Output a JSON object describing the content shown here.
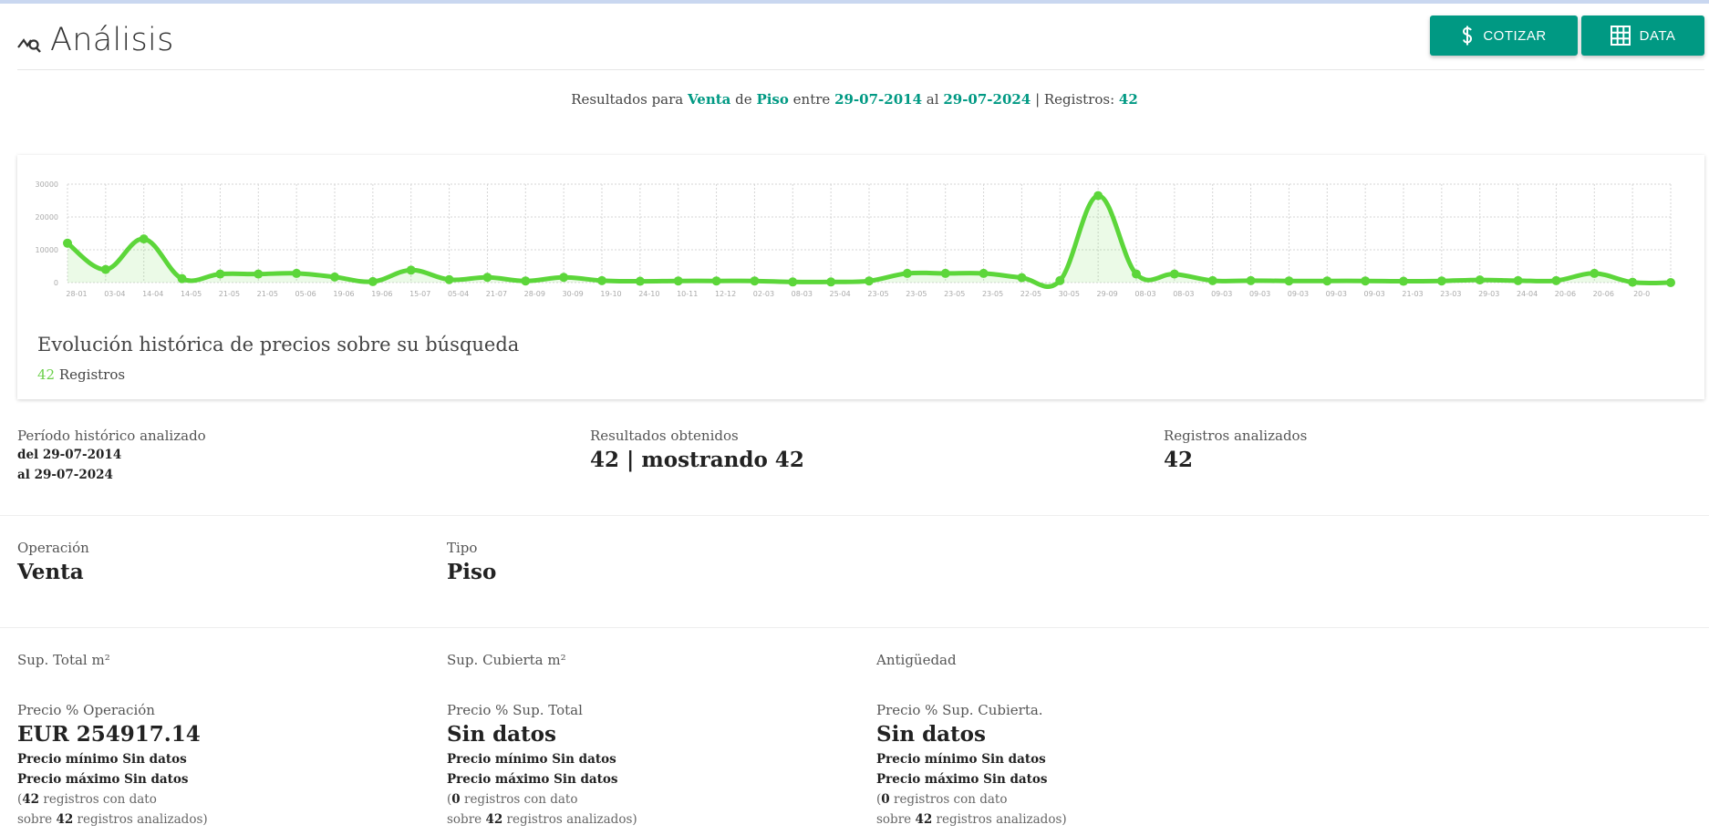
{
  "header": {
    "title": "Análisis",
    "cotizar_label": "COTIZAR",
    "data_label": "DATA"
  },
  "summary": {
    "prefix": "Resultados para",
    "operacion": "Venta",
    "de": "de",
    "tipo": "Piso",
    "entre": "entre",
    "desde": "29-07-2014",
    "al": "al",
    "hasta": "29-07-2024",
    "registros_label": "| Registros:",
    "registros": "42"
  },
  "card": {
    "title": "Evolución histórica de precios sobre su búsqueda",
    "count": "42",
    "count_label": "Registros"
  },
  "chart_data": {
    "type": "area",
    "y_ticks": [
      "30000",
      "20000",
      "10000",
      "0"
    ],
    "ylim": [
      0,
      30000
    ],
    "grid": true,
    "categories": [
      "28-01",
      "03-04",
      "14-04",
      "14-05",
      "21-05",
      "21-05",
      "05-06",
      "19-06",
      "19-06",
      "15-07",
      "05-04",
      "21-07",
      "28-09",
      "30-09",
      "19-10",
      "24-10",
      "10-11",
      "12-12",
      "02-03",
      "08-03",
      "25-04",
      "23-05",
      "23-05",
      "23-05",
      "23-05",
      "22-05",
      "30-05",
      "29-09",
      "08-03",
      "08-03",
      "09-03",
      "09-03",
      "09-03",
      "09-03",
      "09-03",
      "21-03",
      "23-03",
      "29-03",
      "24-04",
      "20-06",
      "20-06",
      "20-0"
    ],
    "series": [
      {
        "values": [
          12000,
          4000,
          13300,
          1200,
          2600,
          2600,
          2800,
          1700,
          300,
          3800,
          900,
          1600,
          500,
          1600,
          600,
          400,
          500,
          500,
          500,
          200,
          200,
          500,
          2800,
          2800,
          2800,
          1500,
          600,
          26500,
          2600,
          2600,
          600,
          600,
          500,
          500,
          500,
          400,
          500,
          800,
          600,
          600,
          2800,
          100,
          0
        ]
      }
    ],
    "color": "#5cd63a"
  },
  "periodo": {
    "label": "Período histórico analizado",
    "line1": "del 29-07-2014",
    "line2": "al 29-07-2024"
  },
  "resultados": {
    "label": "Resultados obtenidos",
    "value": "42 | mostrando 42"
  },
  "registros_analizados": {
    "label": "Registros analizados",
    "value": "42"
  },
  "operacion": {
    "label": "Operación",
    "value": "Venta"
  },
  "tipo": {
    "label": "Tipo",
    "value": "Piso"
  },
  "sup_total": {
    "label": "Sup. Total m²"
  },
  "sup_cubierta": {
    "label": "Sup. Cubierta m²"
  },
  "antiguedad": {
    "label": "Antigüedad"
  },
  "precio_operacion": {
    "label": "Precio % Operación",
    "value": "EUR 254917.14",
    "min": "Precio mínimo Sin datos",
    "max": "Precio máximo Sin datos",
    "count": "42",
    "count_suffix": "registros con dato",
    "total": "42",
    "total_prefix": "sobre",
    "total_suffix": "registros analizados)"
  },
  "precio_sup_total": {
    "label": "Precio % Sup. Total",
    "value": "Sin datos",
    "min": "Precio mínimo Sin datos",
    "max": "Precio máximo Sin datos",
    "count": "0",
    "count_suffix": "registros con dato",
    "total": "42",
    "total_prefix": "sobre",
    "total_suffix": "registros analizados)"
  },
  "precio_sup_cubierta": {
    "label": "Precio % Sup. Cubierta.",
    "value": "Sin datos",
    "min": "Precio mínimo Sin datos",
    "max": "Precio máximo Sin datos",
    "count": "0",
    "count_suffix": "registros con dato",
    "total": "42",
    "total_prefix": "sobre",
    "total_suffix": "registros analizados)"
  }
}
